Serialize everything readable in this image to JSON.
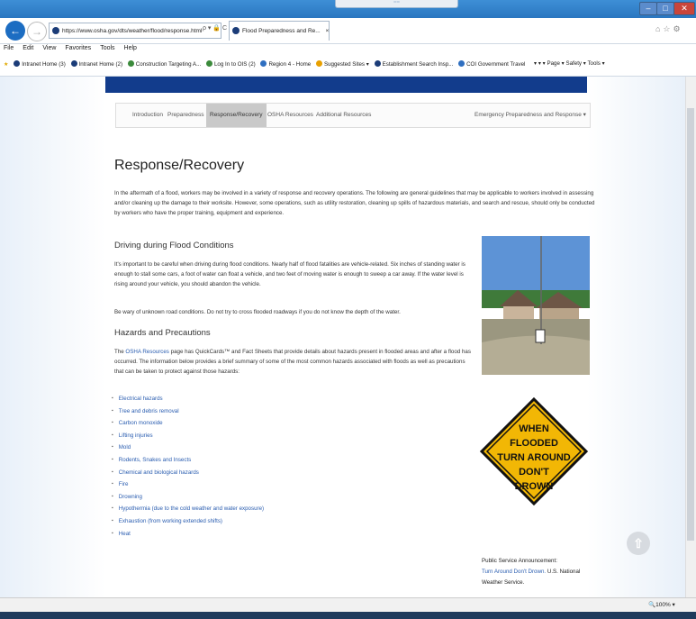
{
  "browser": {
    "url": "https://www.osha.gov/dts/weather/flood/response.html",
    "url_domain": "osha.gov",
    "tab_title": "Flood Preparedness and Re...",
    "tab_close": "×",
    "menu": [
      "File",
      "Edit",
      "View",
      "Favorites",
      "Tools",
      "Help"
    ],
    "favorites": [
      "Intranet Home (3)",
      "Intranet Home (2)",
      "Construction Targeting A...",
      "Log In to OIS (2)",
      "Region 4 - Home",
      "Suggested Sites ▾",
      "Establishment Search Insp...",
      "COI Government Travel"
    ],
    "command_bar": "▾  ▾  ▾  Page ▾  Safety ▾  Tools ▾",
    "zoom": "100%",
    "back_icon": "←",
    "forward_icon": "→",
    "search_ctrl": "ρ ▾ 🔒 C",
    "tab_strip_top": "=="
  },
  "subnav": {
    "items": [
      "Introduction",
      "Preparedness",
      "Response/Recovery",
      "OSHA Resources",
      "Additional Resources"
    ],
    "right_item": "Emergency Preparedness and Response ▾",
    "active_index": 2
  },
  "content": {
    "title": "Response/Recovery",
    "intro": "In the aftermath of a flood, workers may be involved in a variety of response and recovery operations. The following are general guidelines that may be applicable to workers involved in assessing and/or cleaning up the damage to their worksite. However, some operations, such as utility restoration, cleaning up spills of hazardous materials, and search and rescue, should only be conducted by workers who have the proper training, equipment and experience.",
    "driving_heading": "Driving during Flood Conditions",
    "driving_p1": "It's important to be careful when driving during flood conditions. Nearly half of flood fatalities are vehicle-related. Six inches of standing water is enough to stall some cars, a foot of water can float a vehicle, and two feet of moving water is enough to sweep a car away. If the water level is rising around your vehicle, you should abandon the vehicle.",
    "driving_p2": "Be wary of unknown road conditions. Do not try to cross flooded roadways if you do not know the depth of the water.",
    "hazards_heading": "Hazards and Precautions",
    "hazards_p_link": "OSHA Resources",
    "hazards_p_pre": "The",
    "hazards_p_rest": "page has QuickCards™ and Fact Sheets that provide details about hazards present in flooded areas and after a flood has occurred. The information below provides a brief summary of some of the most common hazards associated with floods as well as precautions that can be taken to protect against those hazards:",
    "hazards": [
      "Electrical hazards",
      "Tree and debris removal",
      "Carbon monoxide",
      "Lifting injuries",
      "Mold",
      "Rodents, Snakes and Insects",
      "Chemical and biological hazards",
      "Fire",
      "Drowning",
      "Hypothermia (due to the cold weather and water exposure)",
      "Exhaustion (from working extended shifts)",
      "Heat"
    ],
    "sign_lines": [
      "WHEN",
      "FLOODED",
      "TURN AROUND",
      "DON'T",
      "DROWN"
    ],
    "psa_label": "Public Service Announcement:",
    "psa_link": "Turn Around Don't Drown.",
    "psa_rest": "U.S. National Weather Service."
  },
  "colors": {
    "banner": "#123c8c",
    "link": "#2a5db0",
    "sign": "#f2b705"
  }
}
